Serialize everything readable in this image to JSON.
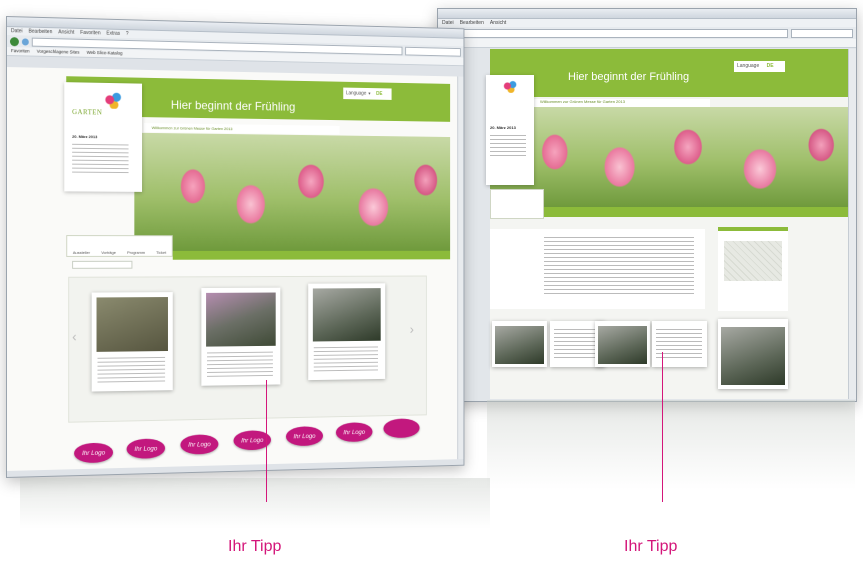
{
  "left_window": {
    "menu": [
      "Datei",
      "Bearbeiten",
      "Ansicht",
      "Favoriten",
      "Extras",
      "?"
    ],
    "favorites": [
      "Favoriten",
      "Vorgeschlagene Sites",
      "Web Slice-Katalog"
    ],
    "headline": "Hier beginnt der Frühling",
    "logo_name": "GARTEN",
    "subtitle": "Willkommen zur Grünen Messe für Garten 2013",
    "date_line": "20. März 2013",
    "language": "Language",
    "language_code": "DE",
    "tabs": [
      "Aussteller",
      "Vorträge",
      "Programm",
      "Ticket"
    ],
    "logo_pills": [
      "Ihr Logo",
      "Ihr Logo",
      "Ihr Logo",
      "Ihr Logo",
      "Ihr Logo",
      "Ihr Logo"
    ]
  },
  "right_window": {
    "headline": "Hier beginnt der Frühling",
    "subtitle": "Willkommen zur Grünen Messe für Garten 2013",
    "date_line": "20. März 2013",
    "language": "Language",
    "language_code": "DE"
  },
  "callouts": {
    "left": "Ihr Tipp",
    "right": "Ihr Tipp"
  },
  "colors": {
    "brand_green": "#8cbb3a",
    "accent_magenta": "#d4167a",
    "pill_magenta": "#c2187e"
  }
}
